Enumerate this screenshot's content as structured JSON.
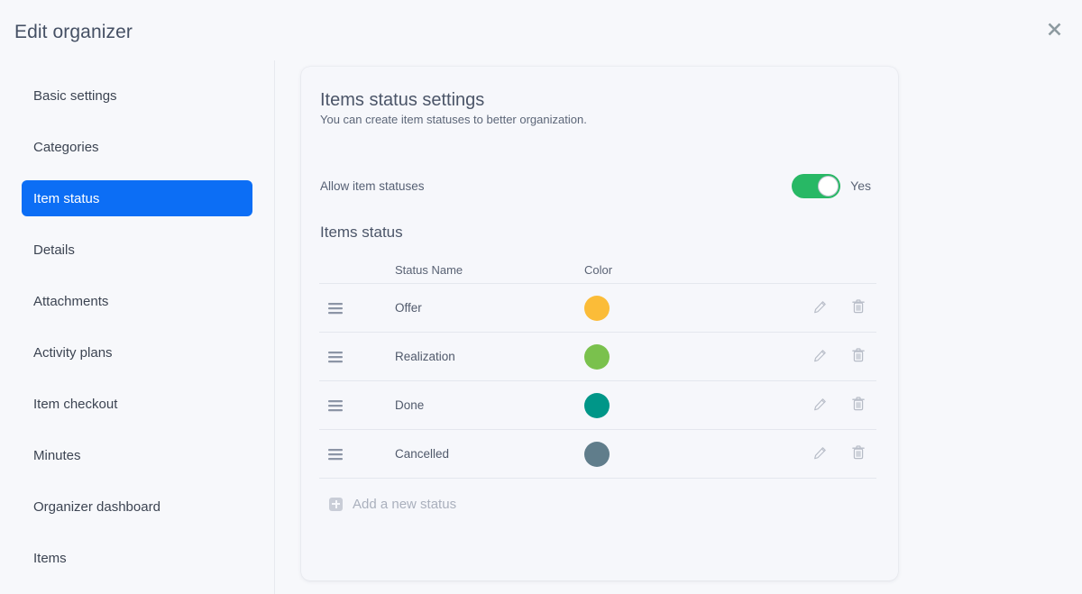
{
  "header": {
    "title": "Edit organizer",
    "close_icon": "close-icon"
  },
  "sidebar": {
    "items": [
      {
        "label": "Basic settings",
        "active": false
      },
      {
        "label": "Categories",
        "active": false
      },
      {
        "label": "Item status",
        "active": true
      },
      {
        "label": "Details",
        "active": false
      },
      {
        "label": "Attachments",
        "active": false
      },
      {
        "label": "Activity plans",
        "active": false
      },
      {
        "label": "Item checkout",
        "active": false
      },
      {
        "label": "Minutes",
        "active": false
      },
      {
        "label": "Organizer dashboard",
        "active": false
      },
      {
        "label": "Items",
        "active": false
      }
    ]
  },
  "card": {
    "title": "Items status settings",
    "subtitle": "You can create item statuses to better organization.",
    "allow": {
      "label": "Allow item statuses",
      "toggle_state": "on",
      "toggle_value_label": "Yes"
    },
    "section_title": "Items status",
    "table": {
      "columns": [
        "",
        "Status Name",
        "Color",
        ""
      ],
      "rows": [
        {
          "handle_icon": "drag-handle-icon",
          "name": "Offer",
          "color": "#fbbc38",
          "edit_icon": "pencil-icon",
          "delete_icon": "trash-icon"
        },
        {
          "handle_icon": "drag-handle-icon",
          "name": "Realization",
          "color": "#7ac14d",
          "edit_icon": "pencil-icon",
          "delete_icon": "trash-icon"
        },
        {
          "handle_icon": "drag-handle-icon",
          "name": "Done",
          "color": "#009688",
          "edit_icon": "pencil-icon",
          "delete_icon": "trash-icon"
        },
        {
          "handle_icon": "drag-handle-icon",
          "name": "Cancelled",
          "color": "#607d8b",
          "edit_icon": "pencil-icon",
          "delete_icon": "trash-icon"
        }
      ]
    },
    "add_row": {
      "icon": "add-square-icon",
      "label": "Add a new status"
    }
  },
  "colors": {
    "accent": "#0c6ef5",
    "toggle_on": "#28b865",
    "page_background": "#f7f8fb",
    "card_background": "#f6f7fb",
    "text": "#4a5363"
  }
}
